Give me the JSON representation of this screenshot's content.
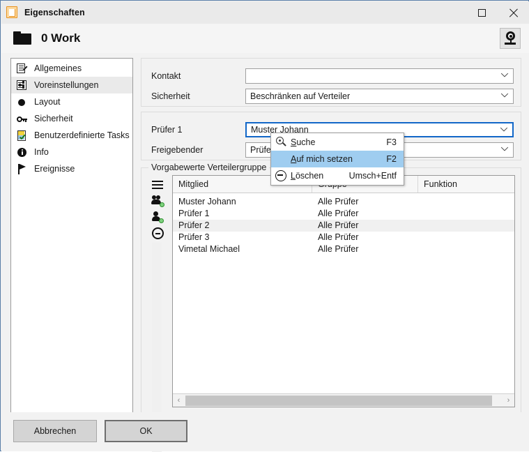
{
  "window": {
    "title": "Eigenschaften",
    "title_icon": "document-icon",
    "maximize_icon": "maximize-icon",
    "close_icon": "close-icon"
  },
  "header": {
    "folder_icon": "folder-icon",
    "title": "0 Work",
    "help_icon": "lifebuoy-icon"
  },
  "sidebar": {
    "items": [
      {
        "label": "Allgemeines",
        "icon": "document-edit-icon",
        "selected": false
      },
      {
        "label": "Voreinstellungen",
        "icon": "sliders-icon",
        "selected": true
      },
      {
        "label": "Layout",
        "icon": "circle-icon",
        "selected": false
      },
      {
        "label": "Sicherheit",
        "icon": "key-icon",
        "selected": false
      },
      {
        "label": "Benutzerdefinierte Tasks",
        "icon": "clipboard-check-icon",
        "selected": false
      },
      {
        "label": "Info",
        "icon": "info-icon",
        "selected": false
      },
      {
        "label": "Ereignisse",
        "icon": "flag-icon",
        "selected": false
      }
    ]
  },
  "form": {
    "group_top": {
      "fields": [
        {
          "label": "Kontakt",
          "value": "",
          "chevron": "chevron-down-icon",
          "focused": false
        },
        {
          "label": "Sicherheit",
          "value": "Beschränken auf Verteiler",
          "chevron": "chevron-down-icon",
          "focused": false
        }
      ]
    },
    "group_mid": {
      "fields": [
        {
          "label": "Prüfer 1",
          "value": "Muster Johann",
          "chevron": "chevron-down-icon",
          "focused": true
        },
        {
          "label": "Freigebender",
          "value": "Prüfer 1",
          "chevron": "chevron-down-icon",
          "focused": false
        }
      ]
    },
    "group_bottom": {
      "legend": "Vorgabewerte Verteilergruppe"
    }
  },
  "table_toolbar": {
    "buttons": [
      {
        "name": "menu-button",
        "icon": "hamburger-icon"
      },
      {
        "name": "add-group-button",
        "icon": "users-add-icon"
      },
      {
        "name": "add-user-button",
        "icon": "user-add-icon"
      },
      {
        "name": "remove-button",
        "icon": "minus-circle-icon"
      }
    ]
  },
  "table": {
    "columns": [
      "Mitglied",
      "Gruppe",
      "Funktion"
    ],
    "rows": [
      {
        "mitglied": "Muster Johann",
        "gruppe": "Alle Prüfer",
        "funktion": "",
        "selected": false
      },
      {
        "mitglied": "Prüfer 1",
        "gruppe": "Alle Prüfer",
        "funktion": "",
        "selected": false
      },
      {
        "mitglied": "Prüfer 2",
        "gruppe": "Alle Prüfer",
        "funktion": "",
        "selected": true
      },
      {
        "mitglied": "Prüfer 3",
        "gruppe": "Alle Prüfer",
        "funktion": "",
        "selected": false
      },
      {
        "mitglied": "Vimetal Michael",
        "gruppe": "Alle Prüfer",
        "funktion": "",
        "selected": false
      }
    ],
    "scrollbar": {
      "left_arrow": "chevron-left-icon",
      "right_arrow": "chevron-right-icon"
    }
  },
  "context_menu": {
    "items": [
      {
        "label": "Suche",
        "accel": "S",
        "shortcut": "F3",
        "icon": "search-icon",
        "highlighted": false
      },
      {
        "label": "Auf mich setzen",
        "accel": "A",
        "shortcut": "F2",
        "icon": "none",
        "highlighted": true
      },
      {
        "label": "Löschen",
        "accel": "L",
        "shortcut": "Umsch+Entf",
        "icon": "minus-circle-icon",
        "highlighted": false
      }
    ]
  },
  "footer": {
    "cancel_label": "Abbrechen",
    "ok_label": "OK"
  },
  "colors": {
    "window_border": "#5a7fa8",
    "titlebar_bg": "#eaeaea",
    "content_bg": "#f2f2f2",
    "focus_border": "#1267c8",
    "menu_highlight": "#9fcdf0",
    "row_selected": "#f0f0f0",
    "icon_accent": "#e8921f"
  }
}
